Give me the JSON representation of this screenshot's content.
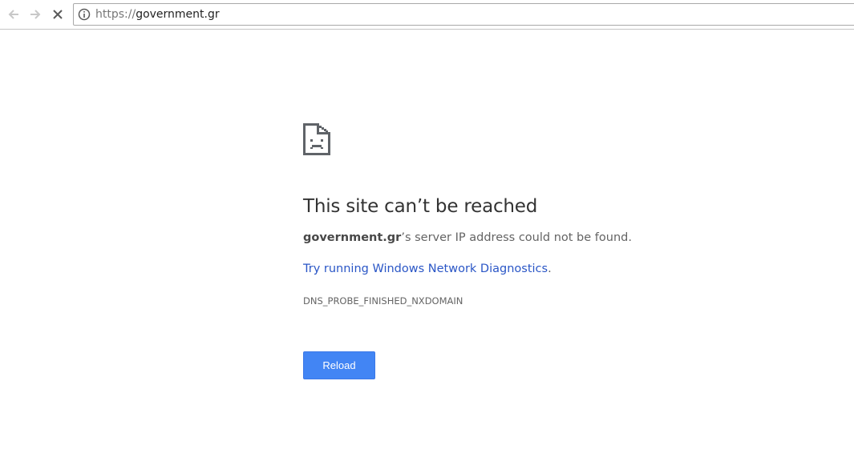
{
  "browser": {
    "url_scheme": "https://",
    "url_host": "government.gr",
    "icons": {
      "back": "arrow-left-icon",
      "forward": "arrow-right-icon",
      "stop": "close-icon",
      "info": "info-icon"
    }
  },
  "error_page": {
    "icon": "sad-document-icon",
    "heading": "This site can’t be reached",
    "summary_domain": "government.gr",
    "summary_rest": "’s server IP address could not be found.",
    "diagnostics_link": "Try running Windows Network Diagnostics",
    "diagnostics_suffix": ".",
    "error_code": "DNS_PROBE_FINISHED_NXDOMAIN",
    "reload_label": "Reload"
  },
  "colors": {
    "button_blue": "#4285f4",
    "link_blue": "#2a56c6"
  }
}
